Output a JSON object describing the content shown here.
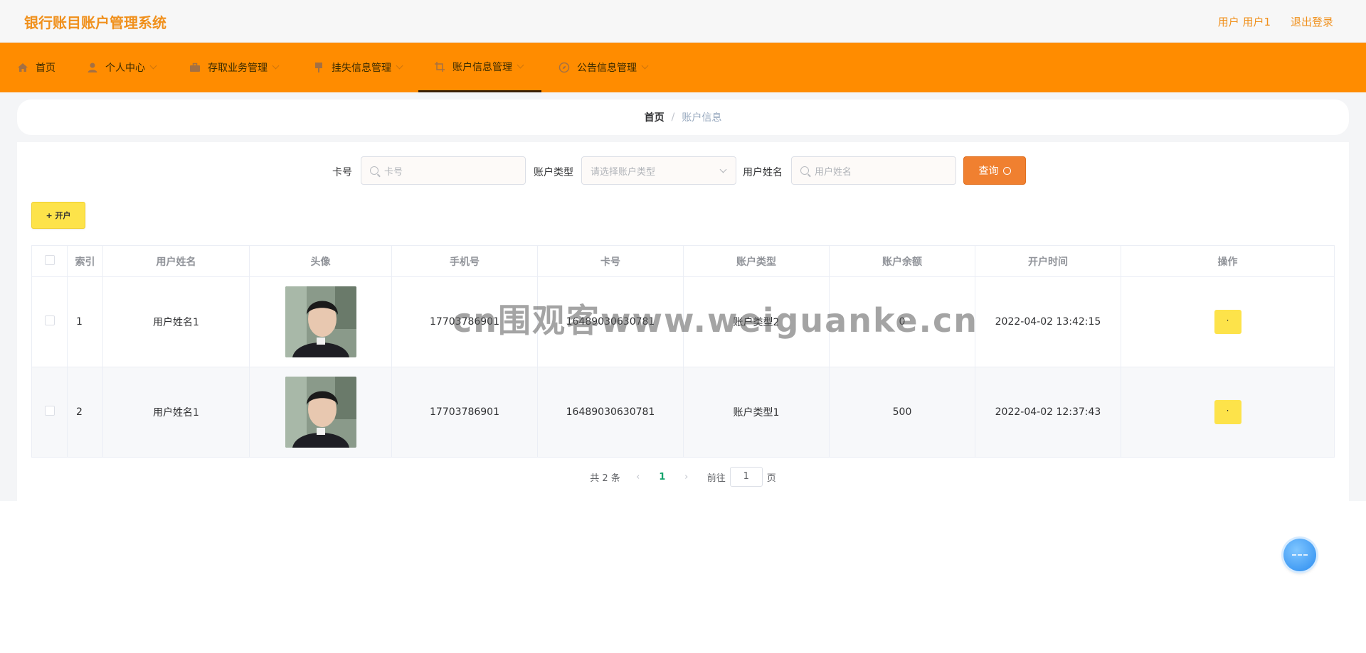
{
  "header": {
    "title": "银行账目账户管理系统",
    "user": "用户 用户1",
    "logout": "退出登录"
  },
  "nav": {
    "items": [
      {
        "label": "首页",
        "icon": "home-icon"
      },
      {
        "label": "个人中心",
        "icon": "user-icon"
      },
      {
        "label": "存取业务管理",
        "icon": "briefcase-icon"
      },
      {
        "label": "挂失信息管理",
        "icon": "pin-icon"
      },
      {
        "label": "账户信息管理",
        "icon": "crop-icon"
      },
      {
        "label": "公告信息管理",
        "icon": "compass-icon"
      }
    ],
    "active_index": 4
  },
  "breadcrumb": {
    "home": "首页",
    "separator": "/",
    "current": "账户信息"
  },
  "search": {
    "card_label": "卡号",
    "card_placeholder": "卡号",
    "type_label": "账户类型",
    "type_placeholder": "请选择账户类型",
    "name_label": "用户姓名",
    "name_placeholder": "用户姓名",
    "query_label": "查询"
  },
  "actions": {
    "open_label": "+ 开户"
  },
  "table": {
    "headers": [
      "索引",
      "用户姓名",
      "头像",
      "手机号",
      "卡号",
      "账户类型",
      "账户余额",
      "开户时间",
      "操作"
    ],
    "rows": [
      {
        "index": "1",
        "name": "用户姓名1",
        "phone": "17703786901",
        "card": "16489030630781",
        "type": "账户类型2",
        "balance": "0",
        "time": "2022-04-02 13:42:15",
        "op": "·"
      },
      {
        "index": "2",
        "name": "用户姓名1",
        "phone": "17703786901",
        "card": "16489030630781",
        "type": "账户类型1",
        "balance": "500",
        "time": "2022-04-02 12:37:43",
        "op": "·"
      }
    ]
  },
  "pagination": {
    "total": "共 2 条",
    "current_page": "1",
    "goto_label": "前往",
    "goto_value": "1",
    "page_suffix": "页"
  },
  "watermark": "cn围观客www.weiguanke.cn",
  "colors": {
    "accent": "#ff8c00",
    "title": "#f0901c",
    "query": "#f08030",
    "yellow": "#fde34a",
    "active_page": "#11a36b"
  }
}
